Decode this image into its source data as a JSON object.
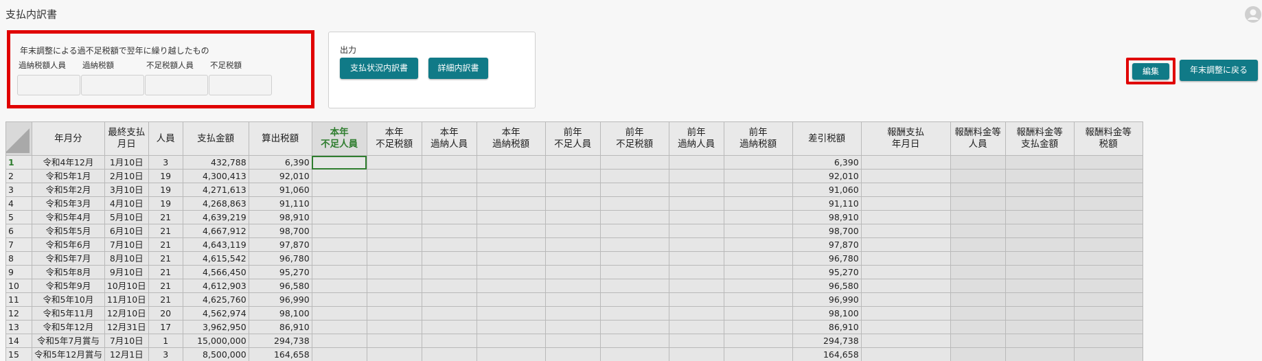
{
  "page": {
    "title": "支払内訳書"
  },
  "summary": {
    "heading": "年末調整による過不足税額で翌年に繰り越したもの",
    "fields": [
      {
        "label": "過納税額人員",
        "value": ""
      },
      {
        "label": "過納税額",
        "value": ""
      },
      {
        "label": "不足税額人員",
        "value": ""
      },
      {
        "label": "不足税額",
        "value": ""
      }
    ]
  },
  "output": {
    "label": "出力",
    "payment_button": "支払状況内訳書",
    "detail_button": "詳細内訳書"
  },
  "actions": {
    "edit": "編集",
    "back": "年末調整に戻る"
  },
  "colors": {
    "accent": "#107a87",
    "highlight": "#e00000",
    "selection": "#2f7d2f"
  },
  "table": {
    "headers": [
      "年月分",
      "最終支払\n月日",
      "人員",
      "支払金額",
      "算出税額",
      "本年\n不足人員",
      "本年\n不足税額",
      "本年\n過納人員",
      "本年\n過納税額",
      "前年\n不足人員",
      "前年\n不足税額",
      "前年\n過納人員",
      "前年\n過納税額",
      "差引税額",
      "報酬支払\n年月日",
      "報酬料金等\n人員",
      "報酬料金等\n支払金額",
      "報酬料金等\n税額"
    ],
    "rows": [
      {
        "n": "1",
        "month": "令和4年12月",
        "date": "1月10日",
        "people": "3",
        "amount": "432,788",
        "tax": "6,390",
        "net": "6,390"
      },
      {
        "n": "2",
        "month": "令和5年1月",
        "date": "2月10日",
        "people": "19",
        "amount": "4,300,413",
        "tax": "92,010",
        "net": "92,010"
      },
      {
        "n": "3",
        "month": "令和5年2月",
        "date": "3月10日",
        "people": "19",
        "amount": "4,271,613",
        "tax": "91,060",
        "net": "91,060"
      },
      {
        "n": "4",
        "month": "令和5年3月",
        "date": "4月10日",
        "people": "19",
        "amount": "4,268,863",
        "tax": "91,110",
        "net": "91,110"
      },
      {
        "n": "5",
        "month": "令和5年4月",
        "date": "5月10日",
        "people": "21",
        "amount": "4,639,219",
        "tax": "98,910",
        "net": "98,910"
      },
      {
        "n": "6",
        "month": "令和5年5月",
        "date": "6月10日",
        "people": "21",
        "amount": "4,667,912",
        "tax": "98,700",
        "net": "98,700"
      },
      {
        "n": "7",
        "month": "令和5年6月",
        "date": "7月10日",
        "people": "21",
        "amount": "4,643,119",
        "tax": "97,870",
        "net": "97,870"
      },
      {
        "n": "8",
        "month": "令和5年7月",
        "date": "8月10日",
        "people": "21",
        "amount": "4,615,542",
        "tax": "96,780",
        "net": "96,780"
      },
      {
        "n": "9",
        "month": "令和5年8月",
        "date": "9月10日",
        "people": "21",
        "amount": "4,566,450",
        "tax": "95,270",
        "net": "95,270"
      },
      {
        "n": "10",
        "month": "令和5年9月",
        "date": "10月10日",
        "people": "21",
        "amount": "4,612,903",
        "tax": "96,580",
        "net": "96,580"
      },
      {
        "n": "11",
        "month": "令和5年10月",
        "date": "11月10日",
        "people": "21",
        "amount": "4,625,760",
        "tax": "96,990",
        "net": "96,990"
      },
      {
        "n": "12",
        "month": "令和5年11月",
        "date": "12月10日",
        "people": "20",
        "amount": "4,562,974",
        "tax": "98,100",
        "net": "98,100"
      },
      {
        "n": "13",
        "month": "令和5年12月",
        "date": "12月31日",
        "people": "17",
        "amount": "3,962,950",
        "tax": "86,910",
        "net": "86,910"
      },
      {
        "n": "14",
        "month": "令和5年7月賞与",
        "date": "7月10日",
        "people": "1",
        "amount": "15,000,000",
        "tax": "294,738",
        "net": "294,738"
      },
      {
        "n": "15",
        "month": "令和5年12月賞与",
        "date": "12月1日",
        "people": "3",
        "amount": "8,500,000",
        "tax": "164,658",
        "net": "164,658"
      }
    ]
  }
}
